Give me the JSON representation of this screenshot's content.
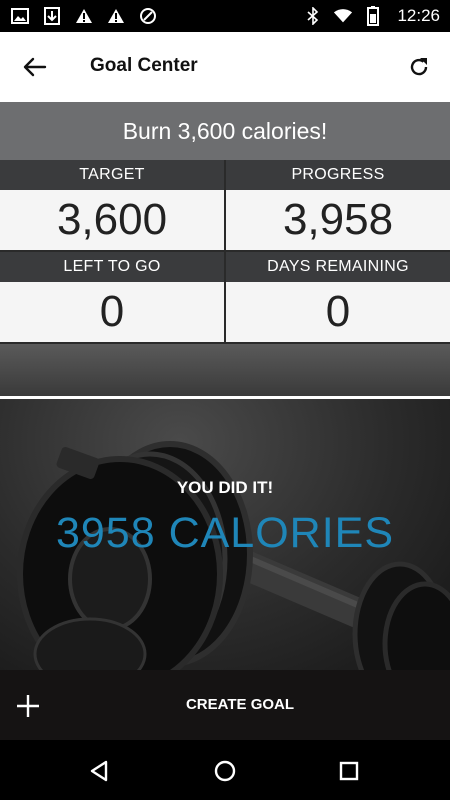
{
  "status_bar": {
    "time": "12:26",
    "left_icons": [
      "image-icon",
      "download-icon",
      "alert-icon",
      "alert-icon",
      "no-sim-icon"
    ],
    "right_icons": [
      "bluetooth-icon",
      "wifi-icon",
      "battery-icon"
    ]
  },
  "app_bar": {
    "title": "Goal Center",
    "back_icon": "arrow-left-icon",
    "refresh_icon": "refresh-icon"
  },
  "goal": {
    "header": "Burn 3,600 calories!",
    "stats": [
      {
        "label": "TARGET",
        "value": "3,600"
      },
      {
        "label": "PROGRESS",
        "value": "3,958"
      },
      {
        "label": "LEFT TO GO",
        "value": "0"
      },
      {
        "label": "DAYS REMAINING",
        "value": "0"
      }
    ]
  },
  "hero": {
    "headline": "YOU DID IT!",
    "result": "3958 CALORIES",
    "result_color": "#1f86b8"
  },
  "action_bar": {
    "create_label": "CREATE GOAL",
    "add_icon": "plus-icon"
  },
  "nav_bar": {
    "icons": [
      "back-triangle-icon",
      "home-circle-icon",
      "recents-square-icon"
    ]
  }
}
